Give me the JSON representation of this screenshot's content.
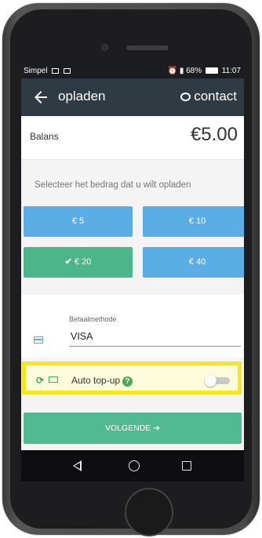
{
  "status_bar": {
    "carrier": "Simpel",
    "battery": "68%",
    "time": "11:07"
  },
  "app_bar": {
    "title": "opladen",
    "contact_label": "contact",
    "back_icon": "arrow-left-icon",
    "contact_icon": "chat-icon"
  },
  "balance": {
    "label": "Balans",
    "value": "€5.00"
  },
  "amount_section": {
    "instruction": "Selecteer het bedrag dat u wilt opladen",
    "options": [
      {
        "label": "€  5",
        "selected": false
      },
      {
        "label": "€  10",
        "selected": false
      },
      {
        "label": "€  20",
        "selected": true
      },
      {
        "label": "€  40",
        "selected": false
      }
    ]
  },
  "payment_method": {
    "label": "Betaalmethode",
    "value": "VISA",
    "icon": "credit-card-icon"
  },
  "auto_topup": {
    "label": "Auto top-up",
    "help_symbol": "?",
    "enabled": false,
    "icons": [
      "refresh-icon",
      "money-icon",
      "help-icon"
    ]
  },
  "next_button": {
    "label": "VOLGENDE",
    "arrow": "➔"
  },
  "colors": {
    "appbar": "#2f3a43",
    "amount_blue": "#5aaee5",
    "amount_selected": "#4db58c",
    "next_button": "#51ba93",
    "highlight_border": "#f6e61b"
  }
}
